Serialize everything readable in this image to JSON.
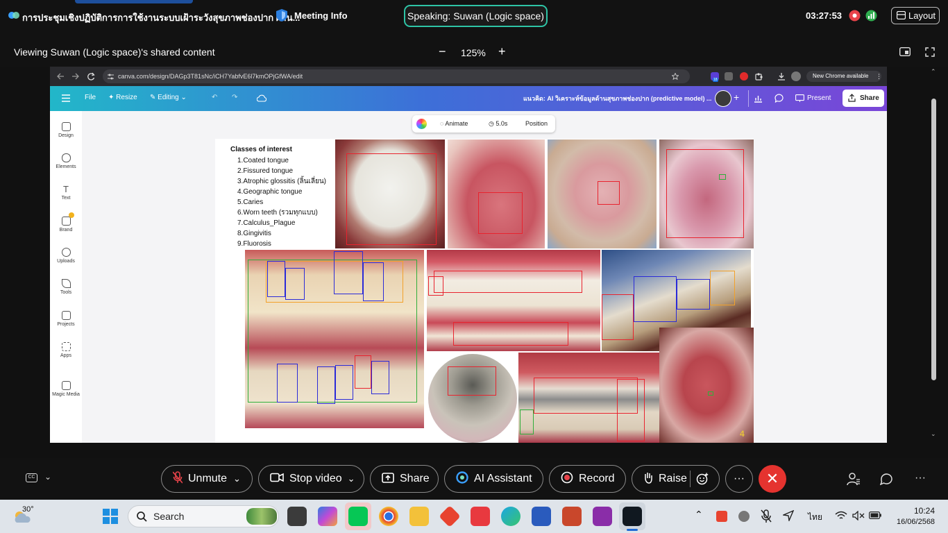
{
  "topbar": {
    "meeting_title": "การประชุมเชิงปฏิบัติการการใช้งานระบบเฝ้าระวังสุขภาพช่องปาก ผ่าน...",
    "meeting_info": "Meeting Info",
    "speaking": "Speaking: Suwan (Logic space)",
    "clock": "03:27:53",
    "layout_label": "Layout"
  },
  "subbar": {
    "viewing": "Viewing Suwan (Logic space)'s shared content",
    "zoom": "125%",
    "zoom_out": "−",
    "zoom_in": "+"
  },
  "browser": {
    "url": "canva.com/design/DAGp3T81sNc/iCH7YabfvE6l7kmOPjGfWA/edit",
    "update_label": "New Chrome available",
    "ext_badge": "18"
  },
  "canva": {
    "file": "File",
    "resize": "Resize",
    "editing": "Editing",
    "doc_title": "แนวคิด: AI วิเคราะห์ข้อมูลด้านสุขภาพช่องปาก (predictive model) ...",
    "present": "Present",
    "share": "Share",
    "toolbar": {
      "animate": "Animate",
      "duration": "5.0s",
      "position": "Position"
    },
    "sidebar": [
      {
        "label": "Design"
      },
      {
        "label": "Elements"
      },
      {
        "label": "Text"
      },
      {
        "label": "Brand"
      },
      {
        "label": "Uploads"
      },
      {
        "label": "Tools"
      },
      {
        "label": "Projects"
      },
      {
        "label": "Apps"
      },
      {
        "label": "Magic Media"
      }
    ]
  },
  "slide": {
    "heading": "Classes of interest",
    "classes": [
      "1.Coated tongue",
      "2.Fissured tongue",
      "3.Atrophic glossitis (ลิ้นเลี่ยน)",
      "4.Geographic tongue",
      "5.Caries",
      "6.Worn teeth (รวมทุกแบบ)",
      "7.Calculus_Plague",
      "8.Gingivitis",
      "9.Fluorosis"
    ],
    "page_number": "4"
  },
  "controls": {
    "unmute": "Unmute",
    "stop_video": "Stop video",
    "share": "Share",
    "ai_assistant": "AI Assistant",
    "record": "Record",
    "raise": "Raise"
  },
  "taskbar": {
    "weather": "30°",
    "search": "Search",
    "language": "ไทย",
    "time": "10:24",
    "date": "16/06/2568"
  },
  "colors": {
    "accent_speaking": "#2ec4a6",
    "end_call": "#e5332f",
    "canva_gradient_start": "#22b7c9",
    "canva_gradient_end": "#7a46d8"
  }
}
